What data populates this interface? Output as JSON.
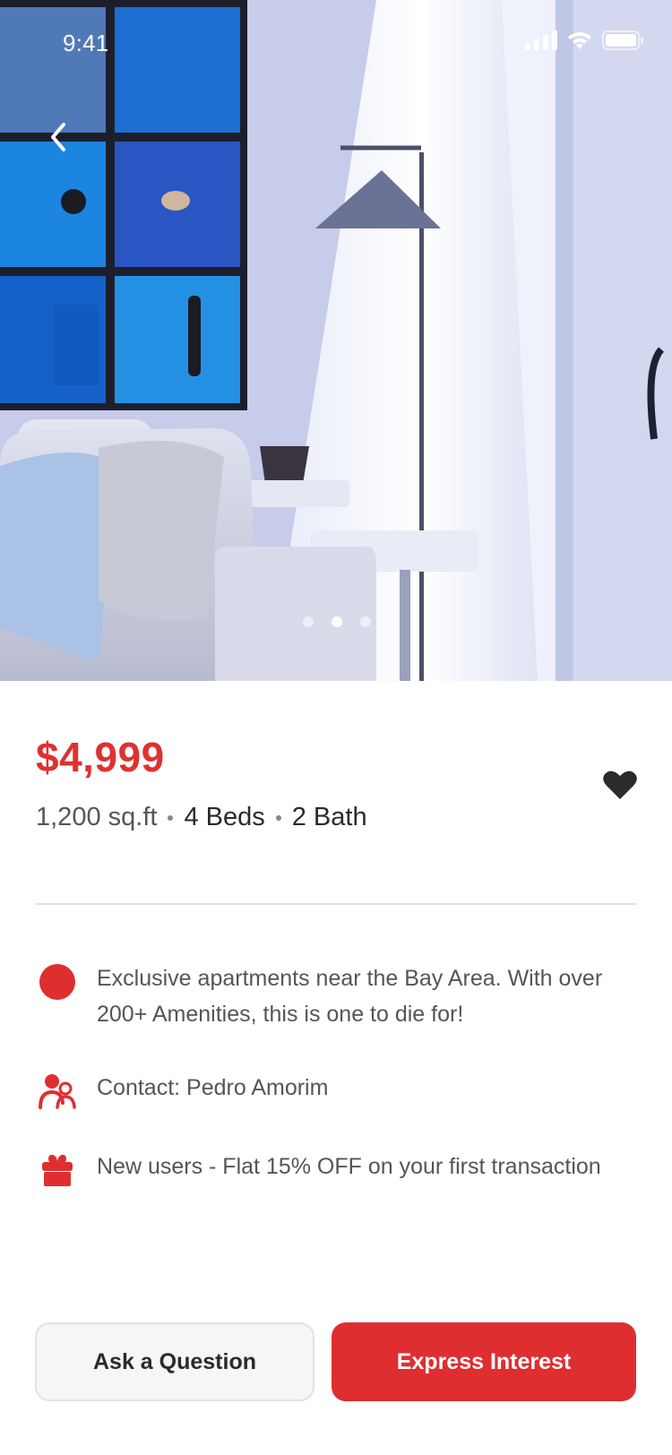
{
  "status_bar": {
    "time": "9:41"
  },
  "listing": {
    "price": "$4,999",
    "area": "1,200 sq.ft",
    "beds": "4 Beds",
    "baths": "2 Bath",
    "favorited": true
  },
  "gallery": {
    "total_images": 3,
    "active_index": 1
  },
  "info": [
    {
      "icon": "location-dot-icon",
      "text": "Exclusive apartments near the Bay Area. With over 200+ Amenities, this is one to die for!"
    },
    {
      "icon": "users-icon",
      "text": "Contact: Pedro Amorim"
    },
    {
      "icon": "gift-icon",
      "text": "New users - Flat 15% OFF on your first transaction"
    }
  ],
  "actions": {
    "ask_label": "Ask a Question",
    "interest_label": "Express Interest"
  },
  "colors": {
    "accent": "#df2e30",
    "price": "#e03131",
    "text_muted": "#555555"
  }
}
